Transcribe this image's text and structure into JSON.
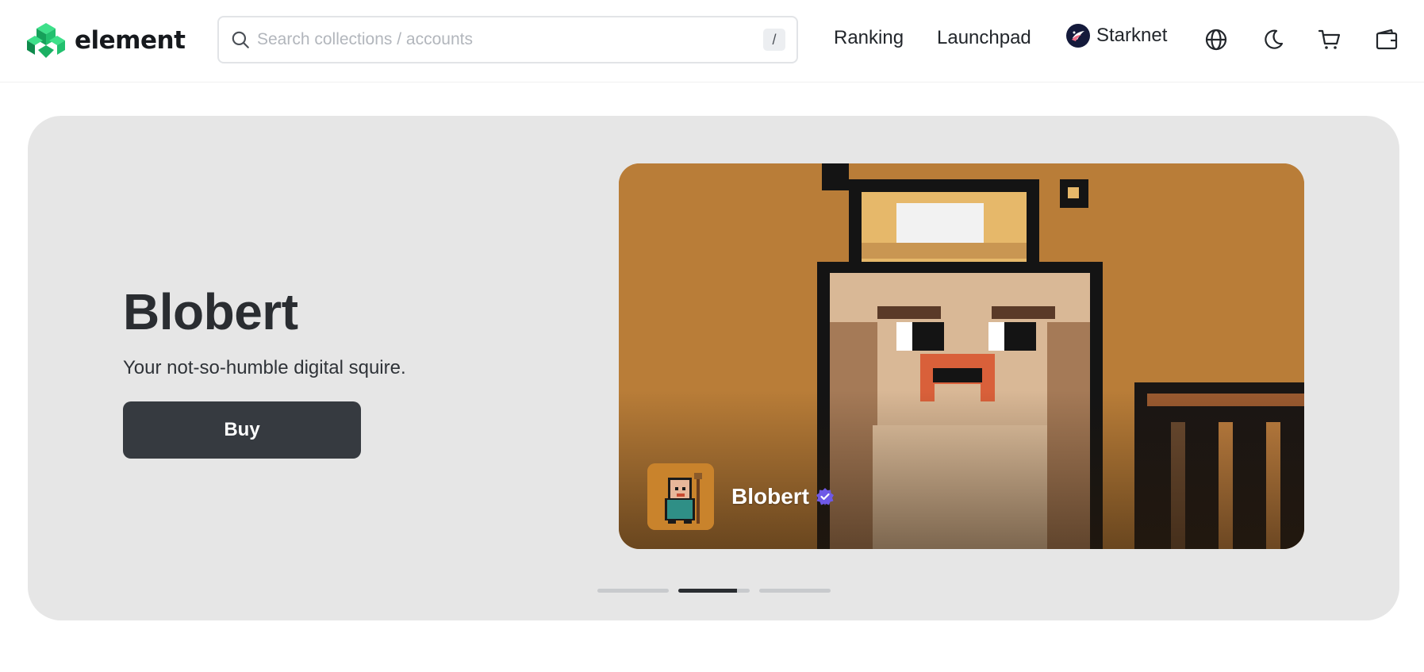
{
  "header": {
    "logo_text": "element",
    "search": {
      "placeholder": "Search collections / accounts",
      "value": "",
      "shortcut": "/"
    },
    "nav": {
      "ranking": "Ranking",
      "launchpad": "Launchpad",
      "network": "Starknet"
    },
    "icons": [
      "globe-icon",
      "moon-icon",
      "cart-icon",
      "wallet-icon"
    ]
  },
  "hero": {
    "title": "Blobert",
    "subtitle": "Your not-so-humble digital squire.",
    "buy_label": "Buy",
    "collection_name": "Blobert",
    "verified": true,
    "slides": [
      {
        "progress": 0
      },
      {
        "progress": 0.82
      },
      {
        "progress": 0
      }
    ]
  },
  "colors": {
    "brand_green": "#28c76f",
    "hero_bg": "#e6e6e6",
    "button_bg": "#363a40",
    "art_bg": "#b97d38",
    "verified_purple": "#6e59e6"
  }
}
